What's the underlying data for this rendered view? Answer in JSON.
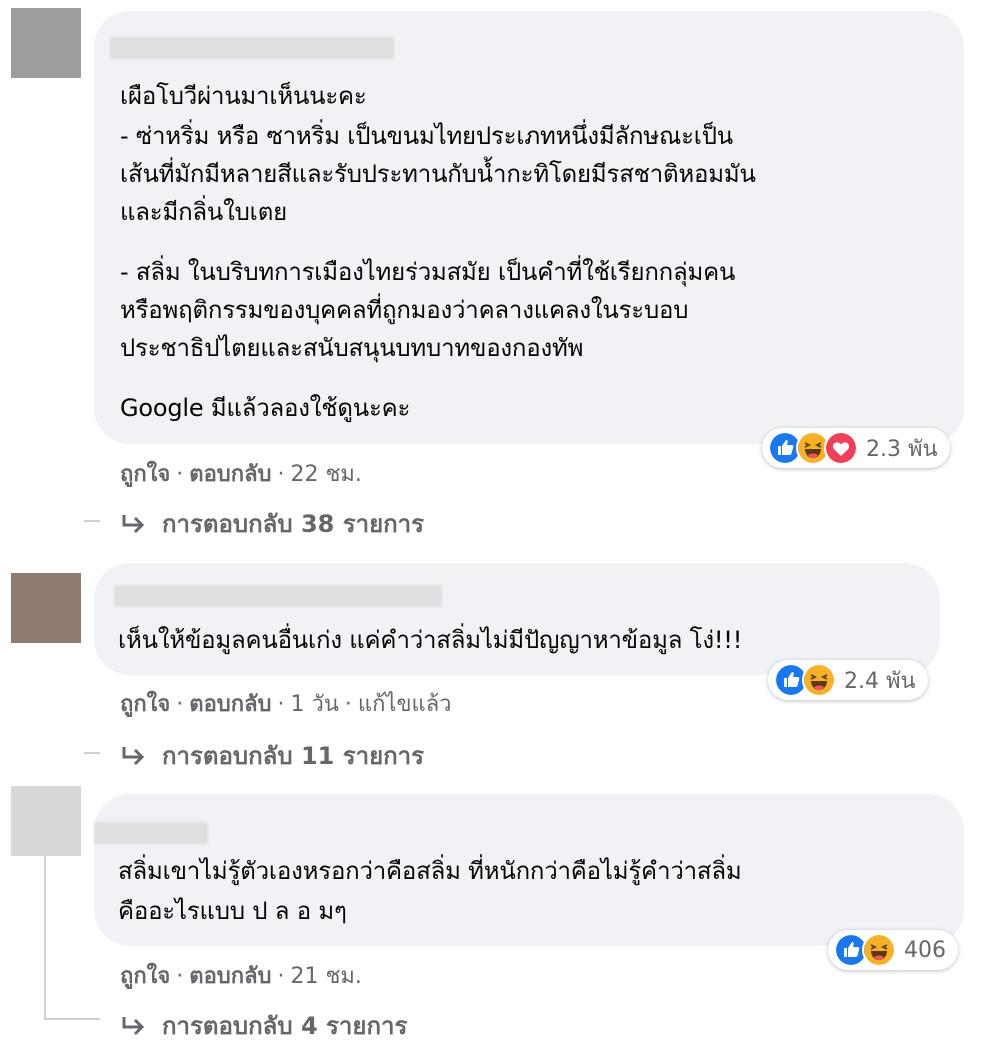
{
  "comments": [
    {
      "lines": [
        "เผือโบวีผ่านมาเห็นนะคะ",
        "- ซ่าหริ่ม หรือ ซาหริ่ม เป็นขนมไทยประเภทหนึ่งมีลักษณะเป็น",
        "เส้นที่มักมีหลายสีและรับประทานกับน้ำกะทิโดยมีรสชาติหอมมัน",
        "และมีกลิ่นใบเตย",
        "- สลิ่ม ในบริบทการเมืองไทยร่วมสมัย เป็นคำที่ใช้เรียกกลุ่มคน",
        "หรือพฤติกรรมของบุคคลที่ถูกมองว่าคลางแคลงในระบอบ",
        "ประชาธิปไตยและสนับสนุนบทบาทของกองทัพ",
        "Google มีแล้วลองใช้ดูนะคะ"
      ],
      "like": "ถูกใจ",
      "reply": "ตอบกลับ",
      "time": "22 ชม.",
      "edited": "",
      "reaction_count": "2.3 พัน",
      "reaction_icons": [
        "like-icon",
        "haha-icon",
        "love-icon"
      ],
      "replies_label": "การตอบกลับ 38 รายการ"
    },
    {
      "lines": [
        "เห็นให้ข้อมูลคนอื่นเก่ง แค่คำว่าสลิ่มไม่มีปัญญาหาข้อมูล โง่!!!"
      ],
      "like": "ถูกใจ",
      "reply": "ตอบกลับ",
      "time": "1 วัน",
      "edited": "แก้ไขแล้ว",
      "reaction_count": "2.4 พัน",
      "reaction_icons": [
        "like-icon",
        "haha-icon"
      ],
      "replies_label": "การตอบกลับ 11 รายการ"
    },
    {
      "lines": [
        "สลิ่มเขาไม่รู้ตัวเองหรอกว่าคือสลิ่ม ที่หนักกว่าคือไม่รู้คำว่าสลิ่ม",
        "คืออะไรแบบ ป ล อ มๆ"
      ],
      "like": "ถูกใจ",
      "reply": "ตอบกลับ",
      "time": "21 ชม.",
      "edited": "",
      "reaction_count": "406",
      "reaction_icons": [
        "like-icon",
        "haha-icon"
      ],
      "replies_label": "การตอบกลับ 4 รายการ"
    }
  ],
  "separator": "·",
  "colors": {
    "bubble": "#f0f2f5",
    "meta_text": "#65676b",
    "like_blue": "#1877f2",
    "haha_yellow": "#f7b125",
    "love_red": "#f33e58"
  }
}
